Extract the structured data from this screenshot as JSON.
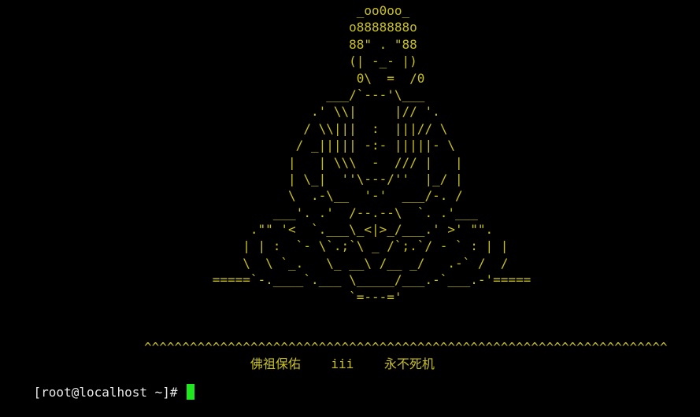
{
  "terminal": {
    "text_color": "#c8c020",
    "background": "#000000",
    "cursor_color": "#1ee81e",
    "art_lines": [
      "                                               _oo0oo_",
      "                                              o8888888o",
      "                                              88\" . \"88",
      "                                              (| -_- |)",
      "                                               0\\  =  /0",
      "                                           ___/`---'\\___",
      "                                         .' \\\\|     |// '.",
      "                                        / \\\\|||  :  |||// \\",
      "                                       / _||||| -:- |||||- \\",
      "                                      |   | \\\\\\  -  /// |   |",
      "                                      | \\_|  ''\\---/''  |_/ |",
      "                                      \\  .-\\__  '-'  ___/-. /",
      "                                    ___'. .'  /--.--\\  `. .'___",
      "                                 .\"\" '<  `.___\\_<|>_/___.' >' \"\".",
      "                                | | :  `- \\`.;`\\ _ /`;.`/ - ` : | |",
      "                                \\  \\ `_.   \\_ __\\ /__ _/   .-` /  /",
      "                            =====`-.____`.___ \\_____/___.-`___.-'=====",
      "                                              `=---='",
      "",
      "",
      "                   ^^^^^^^^^^^^^^^^^^^^^^^^^^^^^^^^^^^^^^^^^^^^^^^^^^^^^^^^^^^^^^^^^^^^^",
      "                                 佛祖保佑    iii    永不死机"
    ],
    "prompt": "[root@localhost ~]# "
  }
}
